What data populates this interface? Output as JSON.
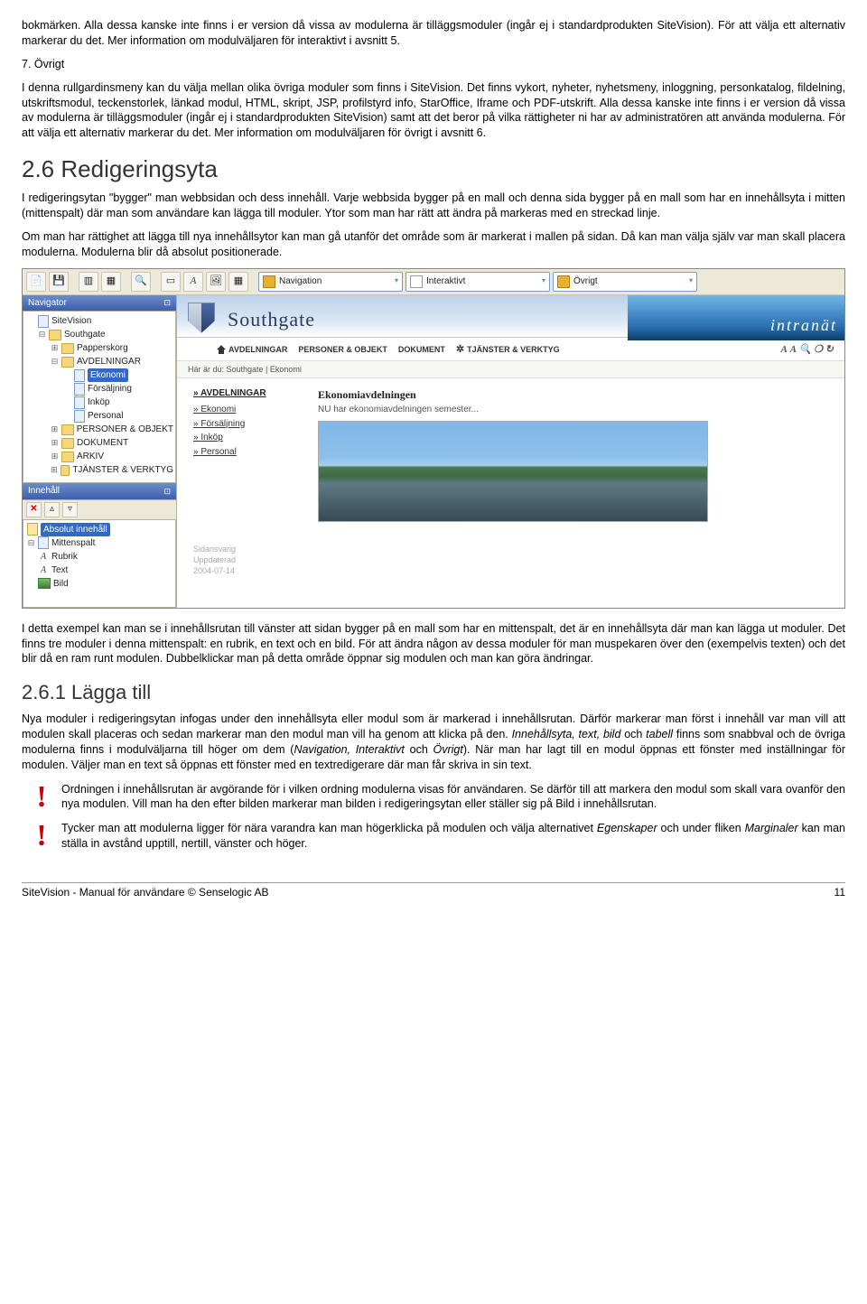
{
  "para_bokmarken": "bokmärken. Alla dessa kanske inte finns i er version då vissa av modulerna är tilläggsmoduler (ingår ej i standardprodukten SiteVision). För att välja ett alternativ markerar du det. Mer information om modulväljaren för interaktivt i avsnitt 5.",
  "ovrigt_title": "7. Övrigt",
  "para_ovrigt": "I denna rullgardinsmeny kan du välja mellan olika övriga moduler som finns i SiteVision. Det finns vykort, nyheter, nyhetsmeny, inloggning, personkatalog, fildelning, utskriftsmodul, teckenstorlek, länkad modul, HTML, skript, JSP, profilstyrd info, StarOffice, Iframe och PDF-utskrift. Alla dessa kanske inte finns i er version då vissa av modulerna är tilläggsmoduler (ingår ej i standardprodukten SiteVision) samt att det beror på vilka rättigheter ni har av administratören att använda modulerna.  För att välja ett alternativ markerar du det. Mer information om modulväljaren för övrigt i avsnitt 6.",
  "h26": "2.6 Redigeringsyta",
  "para26a": "I redigeringsytan \"bygger\" man webbsidan och dess innehåll. Varje webbsida bygger på en mall och denna sida bygger på en mall som har en innehållsyta i mitten (mittenspalt) där man som användare kan lägga till moduler. Ytor som man har rätt att ändra på markeras med en streckad linje.",
  "para26b": "Om man har rättighet att lägga till nya innehållsytor kan man gå utanför det område som är markerat i mallen på sidan. Då kan man välja själv var man skall placera modulerna. Modulerna blir då absolut positionerade.",
  "para26c": "I detta exempel kan man se i innehållsrutan till vänster att sidan bygger på en mall som har en mittenspalt, det är en innehållsyta där man kan lägga ut moduler. Det finns tre moduler i denna mittenspalt: en rubrik, en text och en bild. För att ändra någon av dessa moduler för man muspekaren över den (exempelvis texten) och det blir då en ram runt modulen. Dubbelklickar man på detta område öppnar sig modulen och man kan göra ändringar.",
  "h261": "2.6.1 Lägga till",
  "para261_a": "Nya moduler i redigeringsytan infogas under den innehållsyta eller modul som är markerad i innehållsrutan. Därför markerar man först i innehåll var man vill att modulen skall placeras och sedan markerar man den modul man vill ha genom att klicka på den. ",
  "para261_b": " och ",
  "para261_c": " finns som snabbval och de övriga modulerna finns i modulväljarna till höger om dem (",
  "para261_d": " och ",
  "para261_e": "). När man har lagt till en modul öppnas ett fönster med inställningar för modulen. Väljer man en text så öppnas ett fönster med en textredigerare där man får skriva in sin text.",
  "it_innehallsyta": "Innehållsyta, text, bild",
  "it_tabell": "tabell",
  "it_nav": "Navigation, Interaktivt",
  "it_ovrigt": "Övrigt",
  "note1": "Ordningen i innehållsrutan är avgörande för i vilken ordning modulerna visas för användaren. Se därför till att markera den modul som skall vara ovanför den nya modulen. Vill man ha den efter bilden markerar man bilden i redigeringsytan eller ställer sig på Bild i innehållsrutan.",
  "note2_a": "Tycker man att modulerna ligger för nära varandra kan man högerklicka på modulen och välja alternativet ",
  "note2_b": " och under fliken ",
  "note2_c": " kan man ställa in avstånd upptill, nertill, vänster och höger.",
  "it_egenskaper": "Egenskaper",
  "it_marginaler": "Marginaler",
  "footer_left": "SiteVision - Manual för användare © Senselogic AB",
  "footer_right": "11",
  "editor": {
    "dropdowns": {
      "nav": "Navigation",
      "inter": "Interaktivt",
      "ovr": "Övrigt"
    },
    "nav_panel": "Navigator",
    "tree": {
      "root": "SiteVision",
      "southgate": "Southgate",
      "papperskorg": "Papperskorg",
      "avdelningar": "AVDELNINGAR",
      "ekonomi": "Ekonomi",
      "forsaljning": "Försäljning",
      "inkop": "Inköp",
      "personal": "Personal",
      "personer": "PERSONER & OBJEKT",
      "dokument": "DOKUMENT",
      "arkiv": "ARKIV",
      "tjanster": "TJÄNSTER & VERKTYG"
    },
    "innehall_title": "Innehåll",
    "innehall": {
      "absolut": "Absolut innehåll",
      "mitten": "Mittenspalt",
      "rubrik": "Rubrik",
      "text": "Text",
      "bild": "Bild"
    },
    "page": {
      "brand": "Southgate",
      "banner": "intranät",
      "tabs": {
        "avd": "AVDELNINGAR",
        "pers": "PERSONER & OBJEKT",
        "dok": "DOKUMENT",
        "tj": "TJÄNSTER & VERKTYG"
      },
      "breadcrumb": "Här är du: Southgate | Ekonomi",
      "menu_hd": "AVDELNINGAR",
      "menu": [
        "Ekonomi",
        "Försäljning",
        "Inköp",
        "Personal"
      ],
      "h": "Ekonomiavdelningen",
      "sub": "NU har ekonomiavdelningen semester...",
      "sidansvarig": "Sidansvarig",
      "uppdaterad": "Uppdaterad",
      "date": "2004-07-14"
    }
  }
}
